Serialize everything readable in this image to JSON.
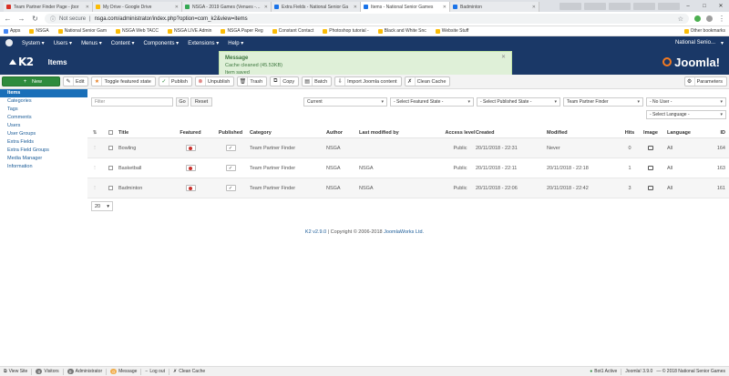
{
  "browser": {
    "tabs": [
      {
        "title": "Team Partner Finder Page - jbor",
        "color": "#d93025",
        "active": false
      },
      {
        "title": "My Drive - Google Drive",
        "color": "#fbbc05",
        "active": false
      },
      {
        "title": "NSGA - 2019 Games (Venues - Sc",
        "color": "#34a853",
        "active": false
      },
      {
        "title": "Extra Fields - National Senior Ga",
        "color": "#1a73e8",
        "active": false
      },
      {
        "title": "Items - National Senior Games",
        "color": "#1a73e8",
        "active": true
      },
      {
        "title": "Badminton",
        "color": "#1a73e8",
        "active": false
      }
    ],
    "not_secure": "Not secure",
    "url": "nsga.com/administrator/index.php?option=com_k2&view=items",
    "bookmarks": [
      "Apps",
      "NSGA",
      "National Senior Gam",
      "NSGA Web TACC",
      "NSGA LIVE Admin",
      "NSGA Paper Reg",
      "Constant Contact",
      "Photoshop tutorial -",
      "Black and White Snc",
      "Website Stuff"
    ],
    "other_bookmarks": "Other bookmarks"
  },
  "topmenu": {
    "items": [
      "System",
      "Users",
      "Menus",
      "Content",
      "Components",
      "Extensions",
      "Help"
    ],
    "site_name": "National Senio..."
  },
  "header": {
    "logo": "K2",
    "page_title": "Items",
    "brand": "Joomla!"
  },
  "message": {
    "title": "Message",
    "lines": [
      "Cache cleaned (45.53KB)",
      "Item saved"
    ]
  },
  "toolbar": {
    "new": "New",
    "edit": "Edit",
    "toggle_featured": "Toggle featured state",
    "publish": "Publish",
    "unpublish": "Unpublish",
    "trash": "Trash",
    "copy": "Copy",
    "batch": "Batch",
    "import": "Import Joomla content",
    "clean_cache": "Clean Cache",
    "parameters": "Parameters"
  },
  "sidebar": {
    "items": [
      "Items",
      "Categories",
      "Tags",
      "Comments",
      "Users",
      "User Groups",
      "Extra Fields",
      "Extra Field Groups",
      "Media Manager",
      "Information"
    ]
  },
  "filters": {
    "filter_placeholder": "Filter",
    "go": "Go",
    "reset": "Reset",
    "state": "Current",
    "featured": "- Select Featured State -",
    "published": "- Select Published State -",
    "category": "Team Partner Finder",
    "user": "- No User -",
    "language": "- Select Language -"
  },
  "table": {
    "headers": {
      "sort": "⇅",
      "title": "Title",
      "featured": "Featured",
      "published": "Published",
      "category": "Category",
      "author": "Author",
      "modified_by": "Last modified by",
      "access": "Access level",
      "created": "Created",
      "modified": "Modified",
      "hits": "Hits",
      "image": "Image",
      "language": "Language",
      "id": "ID"
    },
    "rows": [
      {
        "title": "Bowling",
        "category": "Team Partner Finder",
        "author": "NSGA",
        "modified_by": "",
        "access": "Public",
        "created": "20/11/2018 - 22:31",
        "modified": "Never",
        "hits": "0",
        "language": "All",
        "id": "164"
      },
      {
        "title": "Basketball",
        "category": "Team Partner Finder",
        "author": "NSGA",
        "modified_by": "NSGA",
        "access": "Public",
        "created": "20/11/2018 - 22:11",
        "modified": "20/11/2018 - 22:18",
        "hits": "1",
        "language": "All",
        "id": "163"
      },
      {
        "title": "Badminton",
        "category": "Team Partner Finder",
        "author": "NSGA",
        "modified_by": "NSGA",
        "access": "Public",
        "created": "20/11/2018 - 22:06",
        "modified": "20/11/2018 - 22:42",
        "hits": "3",
        "language": "All",
        "id": "161"
      }
    ]
  },
  "pagination": {
    "per_page": "20"
  },
  "footer": {
    "version": "K2 v2.9.0",
    "copyright": "| Copyright © 2006-2018",
    "company": "JoomlaWorks Ltd."
  },
  "statusbar": {
    "view_site": "View Site",
    "visitors_count": "0",
    "visitors": "Visitors",
    "admin_count": "0",
    "administrator": "Administrator",
    "message_count": "0",
    "message": "Message",
    "logout": "Log out",
    "clean_cache": "Clean Cache",
    "bot_active": "Bot1 Active",
    "joomla_version": "Joomla! 3.9.0",
    "copyright": "— © 2018 National Senior Games"
  }
}
